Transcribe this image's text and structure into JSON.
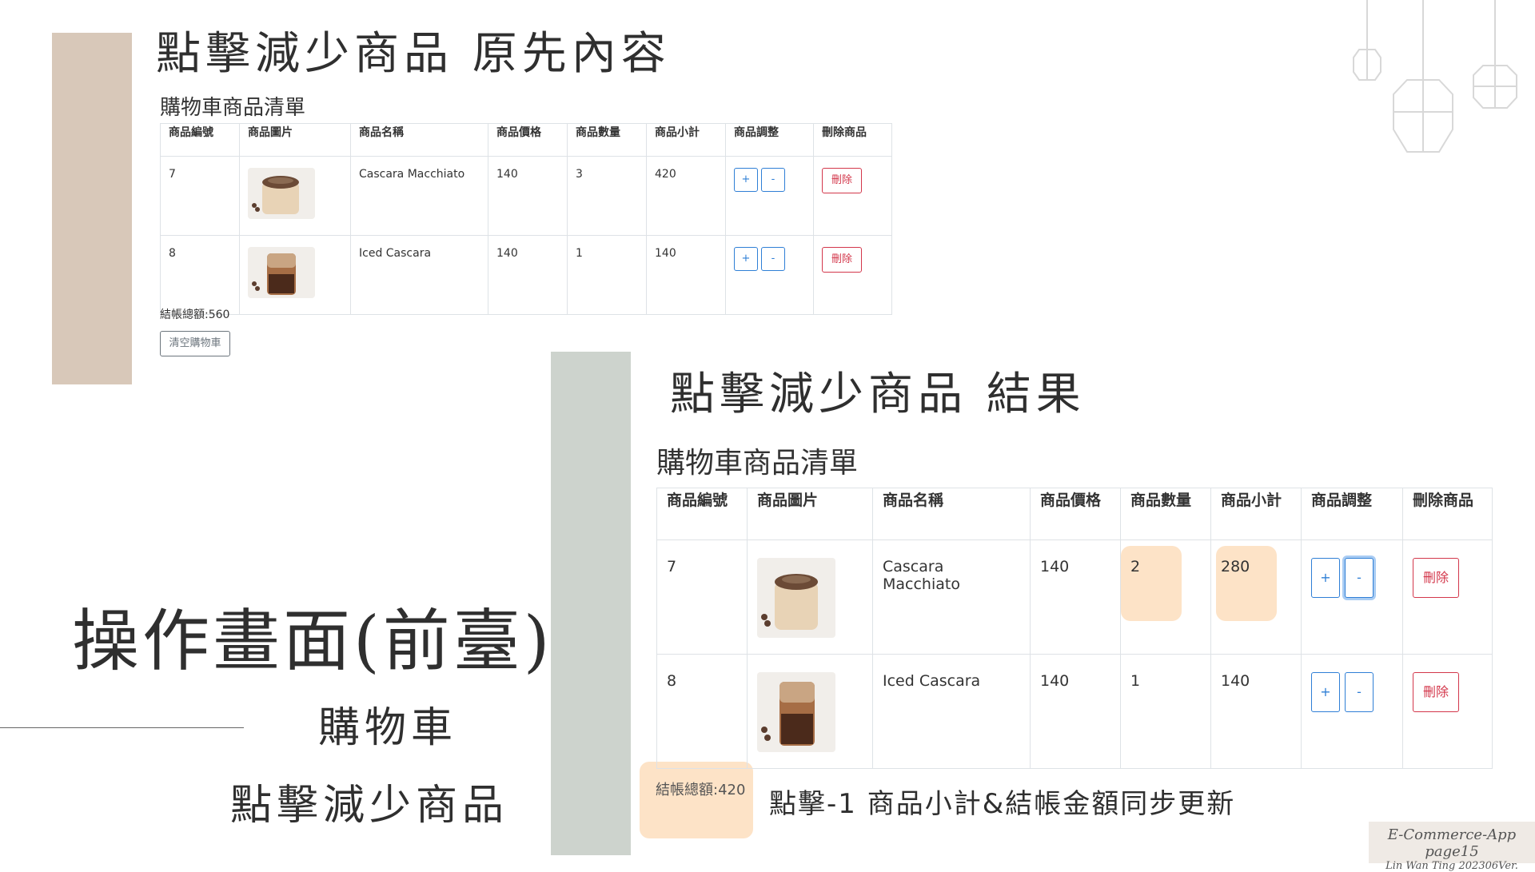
{
  "slide": {
    "title_top": "點擊減少商品 原先內容",
    "title_mid": "點擊減少商品 結果",
    "main_title": "操作畫面(前臺)",
    "subtitle_cart": "購物車",
    "subtitle_click": "點擊減少商品",
    "note": "點擊-1 商品小計&結帳金額同步更新",
    "footer_line1": "E-Commerce-App page15",
    "footer_line2": "Lin Wan Ting 202306Ver."
  },
  "cart_before": {
    "heading": "購物車商品清單",
    "columns": [
      "商品編號",
      "商品圖片",
      "商品名稱",
      "商品價格",
      "商品數量",
      "商品小計",
      "商品調整",
      "刪除商品"
    ],
    "rows": [
      {
        "id": "7",
        "name": "Cascara Macchiato",
        "price": "140",
        "qty": "3",
        "subtotal": "420",
        "plus": "+",
        "minus": "-",
        "delete": "刪除"
      },
      {
        "id": "8",
        "name": "Iced Cascara",
        "price": "140",
        "qty": "1",
        "subtotal": "140",
        "plus": "+",
        "minus": "-",
        "delete": "刪除"
      }
    ],
    "total": "結帳總額:560",
    "clear_button": "清空購物車"
  },
  "cart_after": {
    "heading": "購物車商品清單",
    "columns": [
      "商品編號",
      "商品圖片",
      "商品名稱",
      "商品價格",
      "商品數量",
      "商品小計",
      "商品調整",
      "刪除商品"
    ],
    "rows": [
      {
        "id": "7",
        "name": "Cascara Macchiato",
        "price": "140",
        "qty": "2",
        "subtotal": "280",
        "plus": "+",
        "minus": "-",
        "delete": "刪除"
      },
      {
        "id": "8",
        "name": "Iced Cascara",
        "price": "140",
        "qty": "1",
        "subtotal": "140",
        "plus": "+",
        "minus": "-",
        "delete": "刪除"
      }
    ],
    "total": "結帳總額:420"
  },
  "colors": {
    "tan_bar": "#d8c8b9",
    "grey_bar": "#cdd3cd",
    "highlight": "#fde3c7",
    "primary": "#2f7fd6",
    "danger": "#d3374b"
  }
}
